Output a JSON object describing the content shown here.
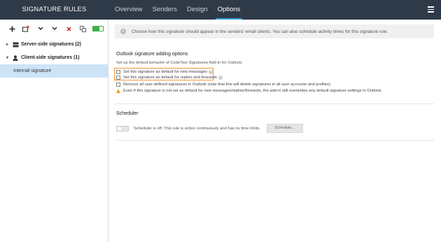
{
  "app": {
    "title": "SIGNATURE RULES"
  },
  "tabs": [
    {
      "label": "Overview"
    },
    {
      "label": "Senders"
    },
    {
      "label": "Design"
    },
    {
      "label": "Options"
    }
  ],
  "toolbar": {
    "icons": [
      "add-icon",
      "add-special-icon",
      "move-down-icon",
      "move-up-icon",
      "delete-icon",
      "copy-icon",
      "toggle-icon"
    ]
  },
  "tree": {
    "server_label": "Server-side signatures (2)",
    "client_label": "Client-side signatures (1)",
    "internal_label": "Internal signature"
  },
  "info": {
    "text": "Choose how this signature should appear in the senders' email clients. You can also schedule activity times for this signature rule."
  },
  "outlook": {
    "title": "Outlook signature adding options",
    "description": "Set up the default behavior of CodeTwo Signatures Add-in for Outlook.",
    "option_new": "Set this signature as default for new messages",
    "option_replies": "Set this signature as default for replies and forwards",
    "option_remove": "Remove all user-defined signatures in Outlook (note that this will delete signatures in all user accounts and profiles)",
    "warning": "Even if this signature is not set as default for new messages/replies/forwards, the add-in still overwrites any default signature settings in Outlook."
  },
  "scheduler": {
    "title": "Scheduler",
    "status_text": "Scheduler is off. This rule is active continuously and has no time limits.",
    "button_label": "Schedule..."
  },
  "colors": {
    "topbar": "#2e3a47",
    "active_tab_underline": "#3aa0d8",
    "selected_row": "#cde4f7",
    "highlight_border": "#f0953b",
    "warning": "#e8a21a"
  }
}
